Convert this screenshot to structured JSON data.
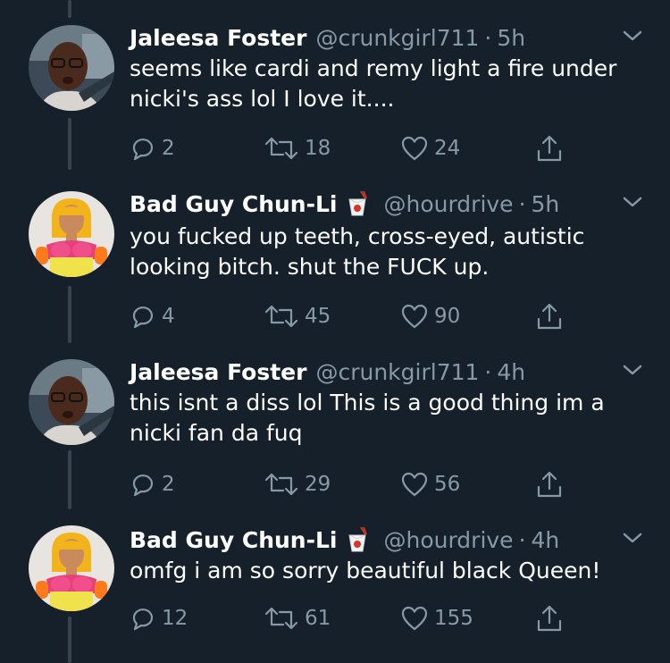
{
  "colors": {
    "background": "#15202b",
    "muted": "#8899a6",
    "thread_line": "#38444d",
    "text": "#ffffff"
  },
  "icons": {
    "reply": "reply-icon",
    "retweet": "retweet-icon",
    "like": "heart-icon",
    "share": "share-icon",
    "menu": "chevron-down-icon",
    "badge": "takeout-box-emoji"
  },
  "tweets": [
    {
      "name": "Jaleesa Foster",
      "handle": "@crunkgirl711",
      "separator": "·",
      "time": "5h",
      "text": "seems like cardi and remy light a fire under nicki's ass lol I love it....",
      "replies": "2",
      "retweets": "18",
      "likes": "24"
    },
    {
      "name": "Bad Guy Chun-Li",
      "handle": "@hourdrive",
      "separator": "·",
      "time": "5h",
      "text": "you fucked up teeth, cross-eyed, autistic looking bitch. shut the FUCK up.",
      "replies": "4",
      "retweets": "45",
      "likes": "90"
    },
    {
      "name": "Jaleesa Foster",
      "handle": "@crunkgirl711",
      "separator": "·",
      "time": "4h",
      "text": "this isnt a diss lol This is a good thing im a nicki fan da fuq",
      "replies": "2",
      "retweets": "29",
      "likes": "56"
    },
    {
      "name": "Bad Guy Chun-Li",
      "handle": "@hourdrive",
      "separator": "·",
      "time": "4h",
      "text": "omfg i am so sorry beautiful black Queen!",
      "replies": "12",
      "retweets": "61",
      "likes": "155"
    }
  ]
}
